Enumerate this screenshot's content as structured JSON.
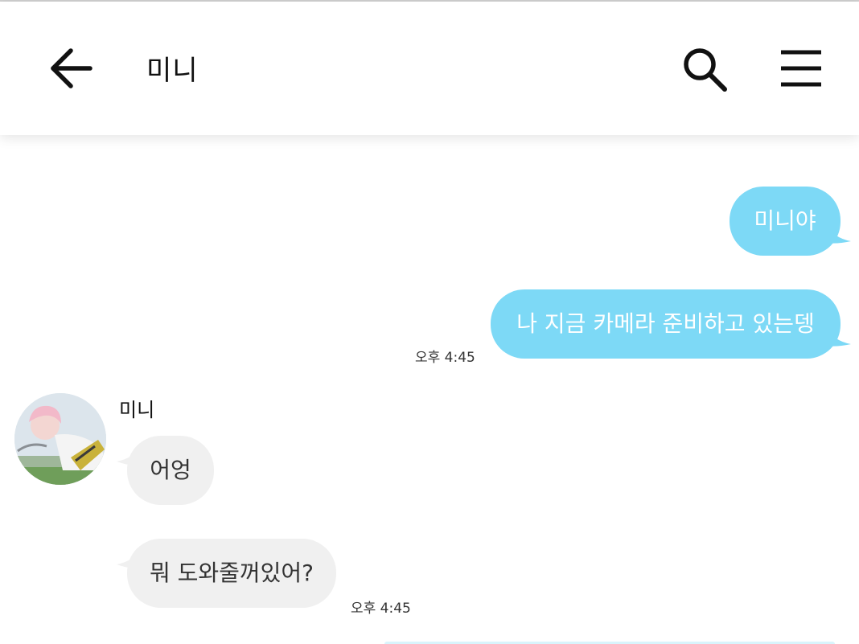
{
  "header": {
    "title": "미니",
    "back_icon": "arrow-left-icon",
    "search_icon": "search-icon",
    "menu_icon": "menu-icon"
  },
  "colors": {
    "outgoing_bubble": "#7dd9f6",
    "incoming_bubble": "#f0f0f0",
    "header_bg": "#ffffff"
  },
  "messages": [
    {
      "direction": "outgoing",
      "text": "미니야"
    },
    {
      "direction": "outgoing",
      "text": "나 지금 카메라 준비하고 있는뎅",
      "time": "오후 4:45"
    },
    {
      "direction": "incoming",
      "sender": "미니",
      "text": "어엉"
    },
    {
      "direction": "incoming",
      "text": "뭐 도와줄꺼있어?",
      "time": "오후 4:45"
    }
  ]
}
